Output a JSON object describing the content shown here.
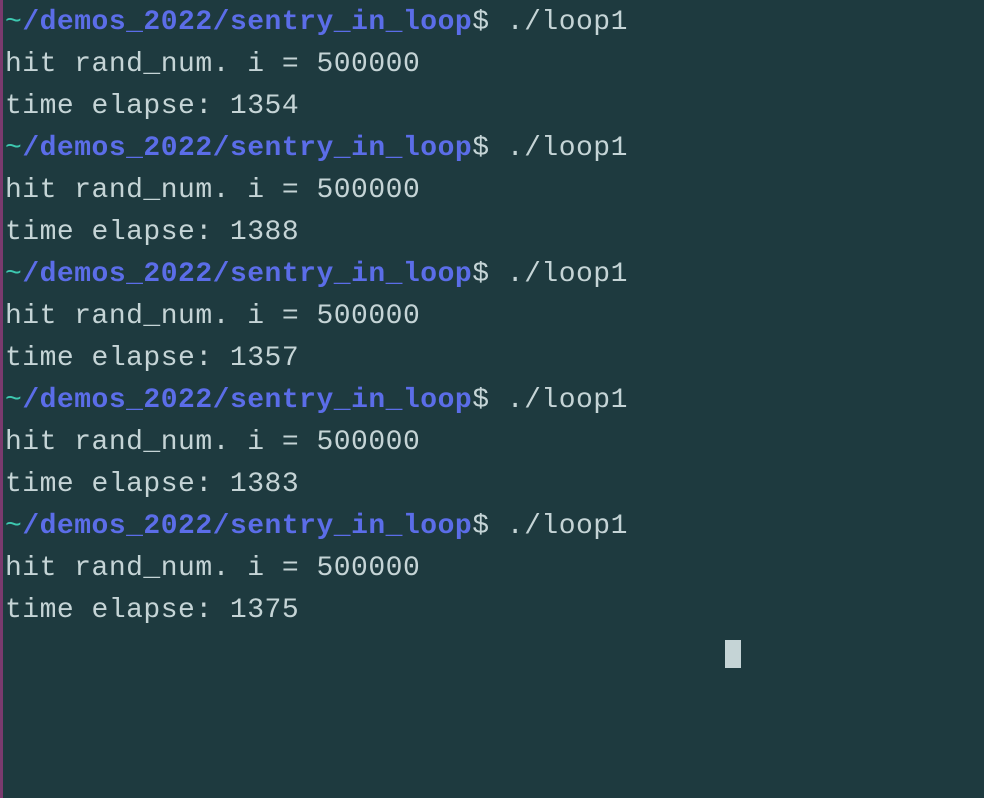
{
  "terminal": {
    "runs": [
      {
        "prompt_tilde": "~",
        "prompt_path": "/demos_2022/sentry_in_loop",
        "prompt_dollar": "$ ",
        "command": "./loop1",
        "output1": "hit rand_num. i = 500000",
        "output2": "time elapse: 1354"
      },
      {
        "prompt_tilde": "~",
        "prompt_path": "/demos_2022/sentry_in_loop",
        "prompt_dollar": "$ ",
        "command": "./loop1",
        "output1": "hit rand_num. i = 500000",
        "output2": "time elapse: 1388"
      },
      {
        "prompt_tilde": "~",
        "prompt_path": "/demos_2022/sentry_in_loop",
        "prompt_dollar": "$ ",
        "command": "./loop1",
        "output1": "hit rand_num. i = 500000",
        "output2": "time elapse: 1357"
      },
      {
        "prompt_tilde": "~",
        "prompt_path": "/demos_2022/sentry_in_loop",
        "prompt_dollar": "$ ",
        "command": "./loop1",
        "output1": "hit rand_num. i = 500000",
        "output2": "time elapse: 1383"
      },
      {
        "prompt_tilde": "~",
        "prompt_path": "/demos_2022/sentry_in_loop",
        "prompt_dollar": "$ ",
        "command": "./loop1",
        "output1": "hit rand_num. i = 500000",
        "output2": "time elapse: 1375"
      }
    ]
  }
}
